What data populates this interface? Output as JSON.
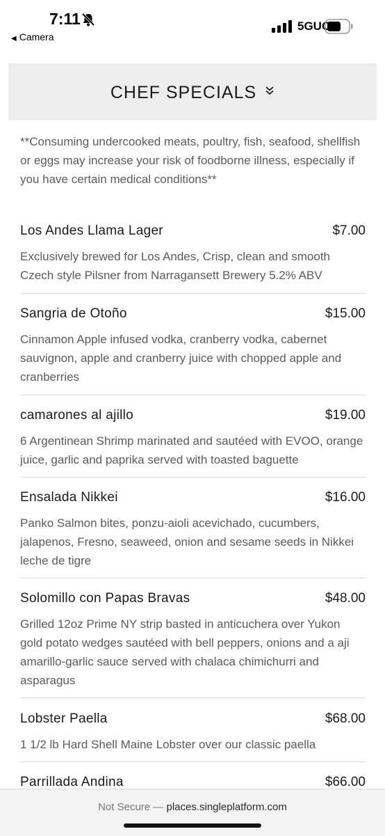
{
  "status_bar": {
    "time": "7:11",
    "back_app": "Camera",
    "network": "5GUC",
    "icons": [
      "bell-slash-icon",
      "cellular-signal-icon",
      "battery-icon"
    ]
  },
  "section": {
    "title": "CHEF SPECIALS",
    "toggle_icon": "double-chevron-down-icon"
  },
  "disclaimer": "**Consuming undercooked meats, poultry, fish, seafood, shellfish or eggs may increase your risk of foodborne illness, especially if you have certain medical conditions**",
  "menu_items": [
    {
      "name": "Los Andes Llama Lager",
      "price": "$7.00",
      "description": "Exclusively brewed for Los Andes, Crisp, clean and smooth Czech style Pilsner from Narragansett Brewery 5.2% ABV"
    },
    {
      "name": "Sangria de Otoño",
      "price": "$15.00",
      "description": "Cinnamon Apple infused vodka, cranberry vodka, cabernet sauvignon, apple and cranberry juice with chopped apple and cranberries"
    },
    {
      "name": "camarones al ajillo",
      "price": "$19.00",
      "description": "6 Argentinean Shrimp marinated and sautéed with EVOO, orange juice, garlic and paprika served with toasted baguette"
    },
    {
      "name": "Ensalada Nikkei",
      "price": "$16.00",
      "description": "Panko Salmon bites, ponzu-aioli acevichado, cucumbers, jalapenos, Fresno, seaweed, onion and sesame seeds in Nikkei leche de tigre"
    },
    {
      "name": "Solomillo con Papas Bravas",
      "price": "$48.00",
      "description": "Grilled 12oz Prime NY strip basted in anticuchera over Yukon gold potato wedges sautéed with bell peppers, onions and a aji amarillo-garlic sauce served with chalaca chimichurri and asparagus"
    },
    {
      "name": "Lobster Paella",
      "price": "$68.00",
      "description": "1 1/2 lb Hard Shell Maine Lobster over our classic paella"
    },
    {
      "name": "Parrillada Andina",
      "price": "$66.00",
      "description": ""
    }
  ],
  "browser": {
    "security_label": "Not Secure",
    "separator": "—",
    "url": "places.singleplatform.com"
  }
}
